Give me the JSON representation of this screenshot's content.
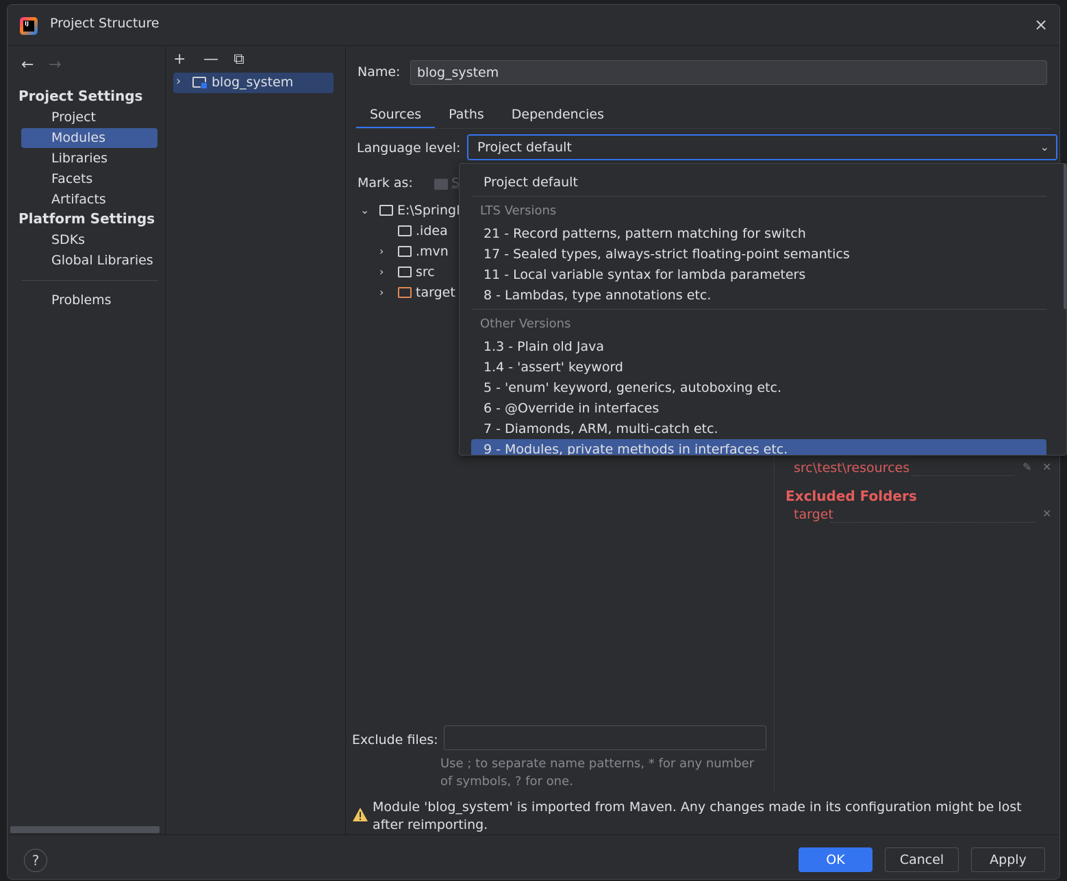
{
  "window": {
    "title": "Project Structure",
    "close_icon": "×"
  },
  "sidebar": {
    "back_icon": "←",
    "forward_icon": "→",
    "project_settings_heading": "Project Settings",
    "project_settings_items": [
      "Project",
      "Modules",
      "Libraries",
      "Facets",
      "Artifacts"
    ],
    "selected_item": "Modules",
    "platform_settings_heading": "Platform Settings",
    "platform_settings_items": [
      "SDKs",
      "Global Libraries"
    ],
    "problems": "Problems"
  },
  "modules_pane": {
    "add_icon": "+",
    "remove_icon": "—",
    "copy_icon": "⧉",
    "module": "blog_system"
  },
  "main": {
    "name_label": "Name:",
    "name_value": "blog_system",
    "tabs": [
      "Sources",
      "Paths",
      "Dependencies"
    ],
    "active_tab": "Sources",
    "language_level_label": "Language level:",
    "language_level_value": "Project default",
    "mark_as_label": "Mark as:",
    "mark_as_partial": "S",
    "tree": {
      "root": "E:\\SpringBo",
      "children": [
        ".idea",
        ".mvn",
        "src",
        "target"
      ]
    },
    "roots": {
      "test_resources": "src\\test\\resources",
      "excluded_heading": "Excluded Folders",
      "excluded_item": "target"
    },
    "exclude_files_label": "Exclude files:",
    "exclude_files_value": "",
    "exclude_hint": "Use ; to separate name patterns, * for any number of symbols, ? for one.",
    "warning": "Module 'blog_system' is imported from Maven. Any changes made in its configuration might be lost after reimporting."
  },
  "dropdown": {
    "project_default": "Project default",
    "lts_heading": "LTS Versions",
    "lts_items": [
      "21 - Record patterns, pattern matching for switch",
      "17 - Sealed types, always-strict floating-point semantics",
      "11 - Local variable syntax for lambda parameters",
      "8 - Lambdas, type annotations etc."
    ],
    "other_heading": "Other Versions",
    "other_items": [
      "1.3 - Plain old Java",
      "1.4 - 'assert' keyword",
      "5 - 'enum' keyword, generics, autoboxing etc.",
      "6 - @Override in interfaces",
      "7 - Diamonds, ARM, multi-catch etc.",
      "9 - Modules, private methods in interfaces etc."
    ],
    "highlighted_item": "9 - Modules, private methods in interfaces etc."
  },
  "footer": {
    "help": "?",
    "ok": "OK",
    "cancel": "Cancel",
    "apply": "Apply"
  },
  "colors": {
    "accent": "#3574f0",
    "selection": "#3d5a9a",
    "excluded_red": "#db5c5c",
    "warning_yellow": "#f2c55c"
  }
}
